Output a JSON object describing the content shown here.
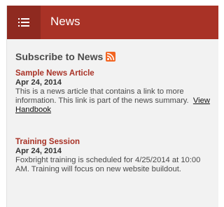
{
  "header": {
    "title": "News",
    "menu_icon": "hamburger-menu-icon",
    "background": "#a93226"
  },
  "subscribe": {
    "label": "Subscribe to News",
    "icon": "rss-feed-icon",
    "icon_color": "#f26522"
  },
  "articles": [
    {
      "title": "Sample News Article",
      "date": "Apr 24, 2014",
      "summary": "This is a news article that contains a link to more information. This link is part of the news summary.",
      "link_label": "View Handbook"
    },
    {
      "title": "Training Session",
      "date": "Apr 24, 2014",
      "summary": "Foxbright training is scheduled for 4/25/2014 at 10:00 AM.  Training will focus on new website buildout.",
      "link_label": ""
    }
  ]
}
